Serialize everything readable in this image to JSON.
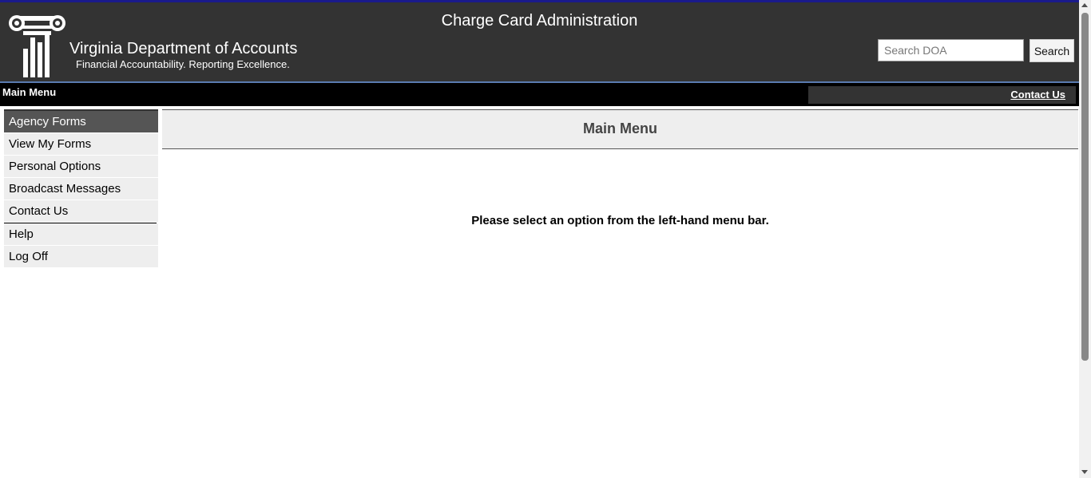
{
  "header": {
    "app_title": "Charge Card Administration",
    "org_name": "Virginia Department of Accounts",
    "org_tagline": "Financial Accountability. Reporting Excellence.",
    "logo_icon": "ionic-column-logo-icon"
  },
  "search": {
    "placeholder": "Search DOA",
    "value": "",
    "button_label": "Search"
  },
  "navbar": {
    "title": "Main Menu",
    "contact_link": "Contact Us"
  },
  "sidebar": {
    "items": [
      {
        "label": "Agency Forms",
        "active": true
      },
      {
        "label": "View My Forms",
        "active": false
      },
      {
        "label": "Personal Options",
        "active": false
      },
      {
        "label": "Broadcast Messages",
        "active": false
      },
      {
        "label": "Contact Us",
        "active": false
      },
      {
        "label": "Help",
        "active": false
      },
      {
        "label": "Log Off",
        "active": false
      }
    ]
  },
  "main": {
    "title": "Main Menu",
    "message": "Please select an option from the left-hand menu bar."
  },
  "colors": {
    "header_bg": "#333333",
    "top_strip": "#1a1a8c",
    "navbar_bg": "#000000",
    "menu_active_bg": "#555555",
    "menu_bg": "#eeeeee"
  }
}
